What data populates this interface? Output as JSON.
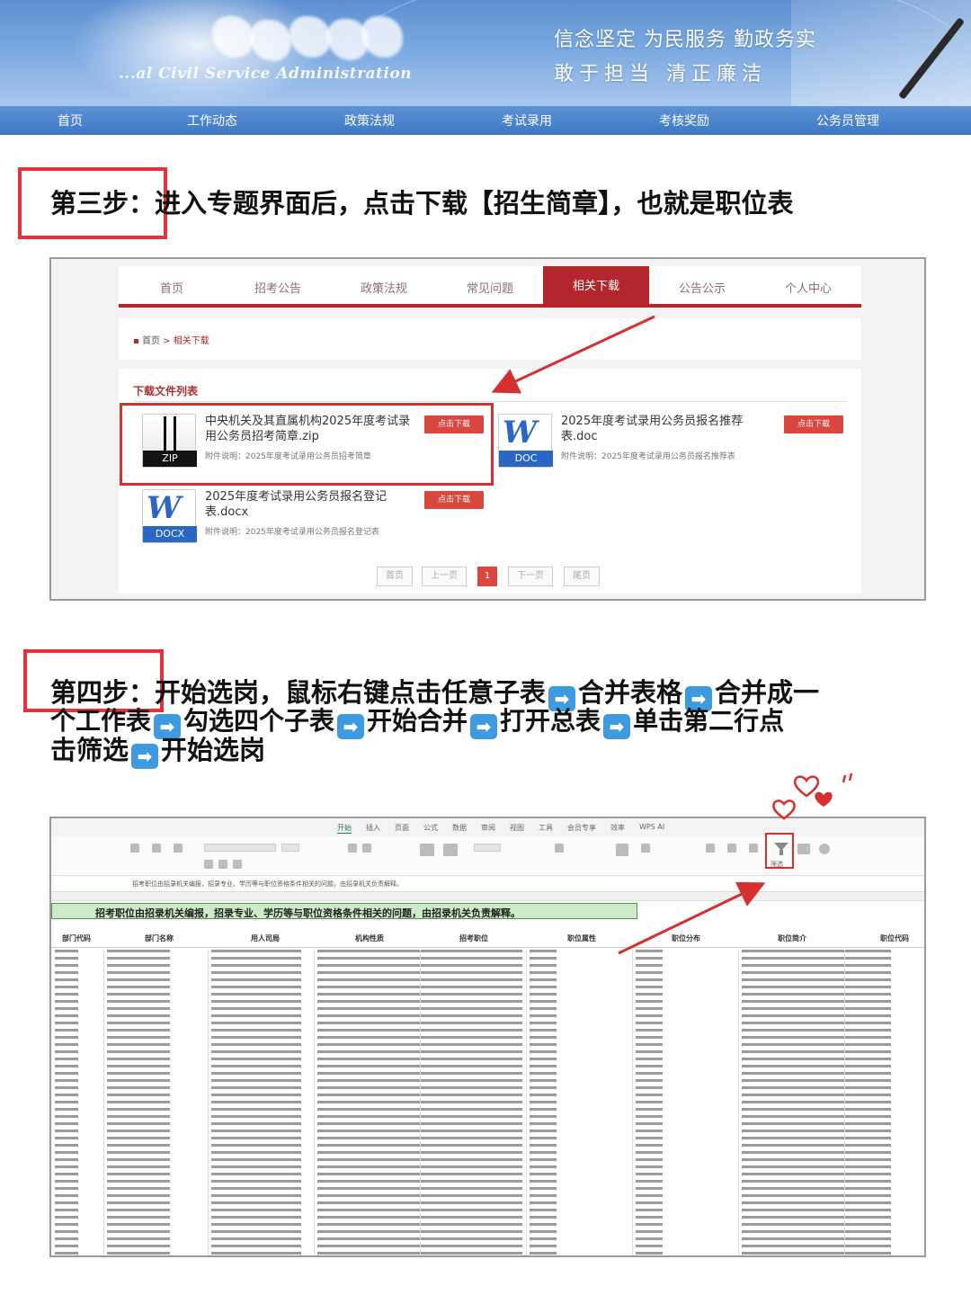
{
  "banner": {
    "english_title": "...al Civil Service Administration",
    "slogan_line1": "信念坚定 为民服务 勤政务实",
    "slogan_line2": "敢于担当  清正廉洁",
    "nav": [
      "首页",
      "工作动态",
      "政策法规",
      "考试录用",
      "考核奖励",
      "公务员管理"
    ]
  },
  "step3": {
    "label": "第三步：",
    "text": "进入专题界面后，点击下载【招生简章】，也就是职位表"
  },
  "download_page": {
    "nav": [
      "首页",
      "招考公告",
      "政策法规",
      "常见问题",
      "相关下载",
      "公告公示",
      "个人中心"
    ],
    "active_nav": "相关下载",
    "breadcrumb": [
      "首页",
      "相关下载"
    ],
    "breadcrumb_sep": ">",
    "panel_title": "下载文件列表",
    "download_label": "点击下载",
    "files": [
      {
        "name": "中央机关及其直属机构2025年度考试录用公务员招考简章.zip",
        "type": "ZIP",
        "desc": "附件说明：2025年度考试录用公务员招考简章"
      },
      {
        "name": "2025年度考试录用公务员报名推荐表.doc",
        "type": "DOC",
        "desc": "附件说明：2025年度考试录用公务员报名推荐表"
      },
      {
        "name": "2025年度考试录用公务员报名登记表.docx",
        "type": "DOCX",
        "desc": "附件说明：2025年度考试录用公务员报名登记表"
      }
    ],
    "pager": [
      "首页",
      "上一页",
      "1",
      "下一页",
      "尾页"
    ]
  },
  "step4": {
    "label": "第四步：",
    "line1_a": "开始选岗，鼠标右键点击任意子表",
    "line1_b": "合并表格",
    "line1_c": "合并成一",
    "line2_a": "个工作表",
    "line2_b": "勾选四个子表",
    "line2_c": "开始合并",
    "line2_d": "打开总表",
    "line2_e": "单击第二行点",
    "line3_a": "击筛选",
    "line3_b": "开始选岗",
    "arrow_glyph": "➡"
  },
  "spreadsheet": {
    "tabs": [
      "开始",
      "插入",
      "页面",
      "公式",
      "数据",
      "审阅",
      "视图",
      "工具",
      "会员专享",
      "效率",
      "WPS AI"
    ],
    "active_tab": "开始",
    "filter_label": "筛选",
    "formula_text": "招考职位由招录机关编报，招录专业、学历等与职位资格条件相关的问题，由招录机关负责解释。",
    "notice": "招考职位由招录机关编报，招录专业、学历等与职位资格条件相关的问题，由招录机关负责解释。",
    "headers": [
      "部门代码",
      "部门名称",
      "用人司局",
      "机构性质",
      "招考职位",
      "职位属性",
      "职位分布",
      "职位简介",
      "职位代码"
    ]
  },
  "colors": {
    "highlight_red": "#d62f2f",
    "nav_red": "#b3262b",
    "banner_blue": "#5d8fd1",
    "arrow_blue": "#3f9be0",
    "sheet_green": "#cfe9c9"
  }
}
